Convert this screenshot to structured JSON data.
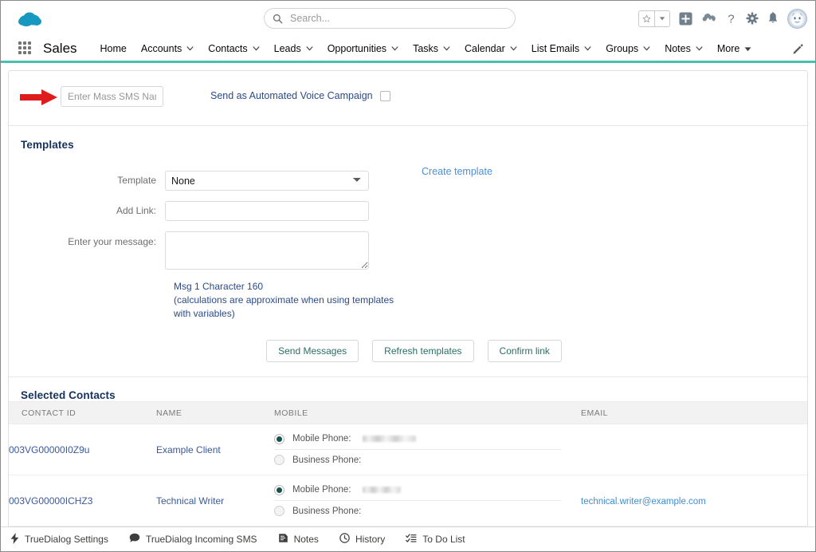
{
  "header": {
    "logo_icon": "salesforce-cloud-logo",
    "search": {
      "placeholder": "Search...",
      "value": "",
      "icon": "search-icon"
    },
    "actions": [
      {
        "name": "favorites-star",
        "icon": "star-icon"
      },
      {
        "name": "favorites-dropdown",
        "icon": "chevron-down-icon"
      },
      {
        "name": "global-add",
        "icon": "plus-square-icon"
      },
      {
        "name": "trailhead",
        "icon": "cloud-mountain-icon"
      },
      {
        "name": "help",
        "icon": "question-mark-icon"
      },
      {
        "name": "setup",
        "icon": "gear-icon"
      },
      {
        "name": "notifications",
        "icon": "bell-icon"
      },
      {
        "name": "user-avatar",
        "icon": "avatar-icon"
      }
    ]
  },
  "app_nav": {
    "waffle_icon": "app-launcher-waffle-icon",
    "app_name": "Sales",
    "pencil_icon": "pencil-edit-icon",
    "items": [
      {
        "label": "Home",
        "has_menu": false
      },
      {
        "label": "Accounts",
        "has_menu": true
      },
      {
        "label": "Contacts",
        "has_menu": true
      },
      {
        "label": "Leads",
        "has_menu": true
      },
      {
        "label": "Opportunities",
        "has_menu": true
      },
      {
        "label": "Tasks",
        "has_menu": true
      },
      {
        "label": "Calendar",
        "has_menu": true
      },
      {
        "label": "List Emails",
        "has_menu": true
      },
      {
        "label": "Groups",
        "has_menu": true
      },
      {
        "label": "Notes",
        "has_menu": true
      },
      {
        "label": "More",
        "has_menu": true
      }
    ]
  },
  "top_panel": {
    "annotation_arrow": "red-arrow-annotation",
    "mass_sms_name": {
      "placeholder": "Enter Mass SMS Name",
      "value": ""
    },
    "voice_campaign_label": "Send as Automated Voice Campaign",
    "voice_campaign_checked": false
  },
  "templates": {
    "title": "Templates",
    "template_label": "Template",
    "template_value": "None",
    "template_options": [
      "None"
    ],
    "add_link_label": "Add Link:",
    "add_link_value": "",
    "message_label": "Enter your message:",
    "message_value": "",
    "create_template_link": "Create template",
    "char_note_line1": "Msg 1 Character 160",
    "char_note_line2": "(calculations are approximate when using templates with variables)",
    "buttons": [
      {
        "label": "Send Messages"
      },
      {
        "label": "Refresh templates"
      },
      {
        "label": "Confirm link"
      }
    ]
  },
  "contacts": {
    "title": "Selected Contacts",
    "columns": [
      "CONTACT ID",
      "NAME",
      "MOBILE",
      "EMAIL"
    ],
    "mobile_option_label": "Mobile Phone:",
    "business_option_label": "Business Phone:",
    "rows": [
      {
        "contact_id": "003VG00000I0Z9u",
        "name": "Example Client",
        "mobile_selected": true,
        "mobile_value": "",
        "business_value": "",
        "email": ""
      },
      {
        "contact_id": "003VG00000ICHZ3",
        "name": "Technical Writer",
        "mobile_selected": true,
        "mobile_value": "",
        "business_value": "",
        "email": "technical.writer@example.com"
      }
    ]
  },
  "utility_bar": {
    "items": [
      {
        "label": "TrueDialog Settings",
        "icon": "lightning-bolt-icon"
      },
      {
        "label": "TrueDialog Incoming SMS",
        "icon": "chat-bubble-icon"
      },
      {
        "label": "Notes",
        "icon": "note-icon"
      },
      {
        "label": "History",
        "icon": "clock-icon"
      },
      {
        "label": "To Do List",
        "icon": "checklist-icon"
      }
    ]
  },
  "colors": {
    "nav_accent": "#4bbfb0",
    "link_blue": "#3f8ed0",
    "heading_navy": "#16325c",
    "button_text": "#2c6e66",
    "radio_selected": "#13544c",
    "annotation_red": "#e01b1b"
  }
}
